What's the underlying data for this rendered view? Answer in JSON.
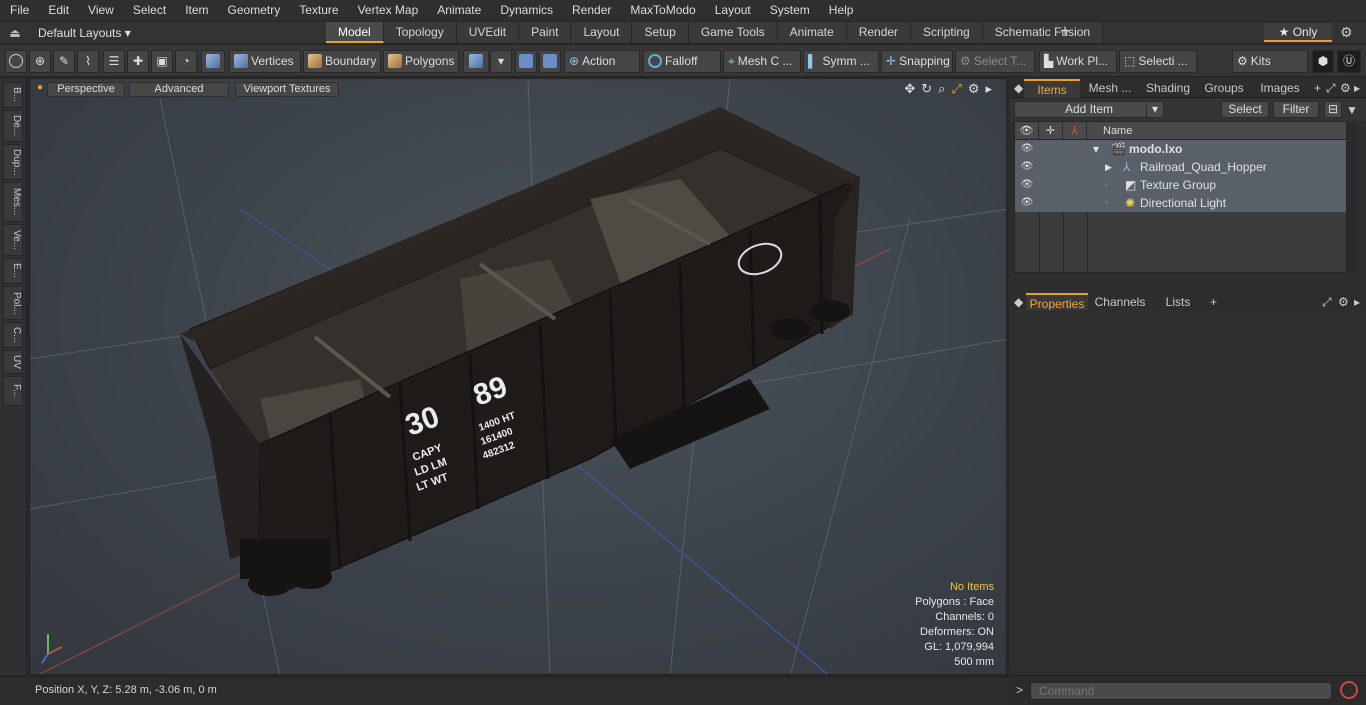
{
  "menu": [
    "File",
    "Edit",
    "View",
    "Select",
    "Item",
    "Geometry",
    "Texture",
    "Vertex Map",
    "Animate",
    "Dynamics",
    "Render",
    "MaxToModo",
    "Layout",
    "System",
    "Help"
  ],
  "layouts": {
    "selector": "Default Layouts ▾"
  },
  "tabs": [
    "Model",
    "Topology",
    "UVEdit",
    "Paint",
    "Layout",
    "Setup",
    "Game Tools",
    "Animate",
    "Render",
    "Scripting",
    "Schematic Fusion"
  ],
  "active_tab": "Model",
  "only_label": "★  Only",
  "toolbar": {
    "vertices": "Vertices",
    "boundary": "Boundary",
    "polygons": "Polygons",
    "action": "Action",
    "falloff": "Falloff",
    "meshc": "Mesh C ...",
    "symm": "Symm ...",
    "snapping": "Snapping",
    "selectt": "Select T...",
    "workpl": "Work Pl...",
    "selecti": "Selecti ...",
    "kits": "Kits"
  },
  "left_tabs": [
    "B...",
    "De...",
    "Dup...",
    "Mes...",
    "Ve...",
    "E...",
    "Pol...",
    "C...",
    "UV",
    "F..."
  ],
  "viewport": {
    "view_mode": "Perspective",
    "advanced": "Advanced",
    "textures": "Viewport Textures",
    "hud": {
      "no_items": "No Items",
      "polygons": "Polygons : Face",
      "channels": "Channels: 0",
      "deformers": "Deformers: ON",
      "gl": "GL: 1,079,994",
      "scale": "500 mm"
    },
    "car_text": {
      "left_number": "30",
      "right_number": "89",
      "left_lines": [
        "CAPY",
        "LD LM",
        "LT WT"
      ],
      "right_lines": [
        "1400 HT",
        "161400",
        "482312"
      ]
    }
  },
  "status": {
    "position": "Position X, Y, Z:   5.28 m, -3.06 m, 0 m"
  },
  "panel": {
    "tabs": [
      "Items",
      "Mesh ...",
      "Shading",
      "Groups",
      "Images"
    ],
    "active": "Items",
    "add_item": "Add Item",
    "select": "Select",
    "filter": "Filter",
    "col_name": "Name",
    "items": [
      {
        "name": "modo.lxo",
        "level": 0
      },
      {
        "name": "Railroad_Quad_Hopper",
        "level": 1
      },
      {
        "name": "Texture Group",
        "level": 1
      },
      {
        "name": "Directional Light",
        "level": 1
      }
    ],
    "lower_tabs": [
      "Properties",
      "Channels",
      "Lists"
    ],
    "command_placeholder": "Command"
  },
  "colors": {
    "accent": "#e8a030",
    "hud_warning": "#f2c544",
    "record": "#d04545"
  }
}
